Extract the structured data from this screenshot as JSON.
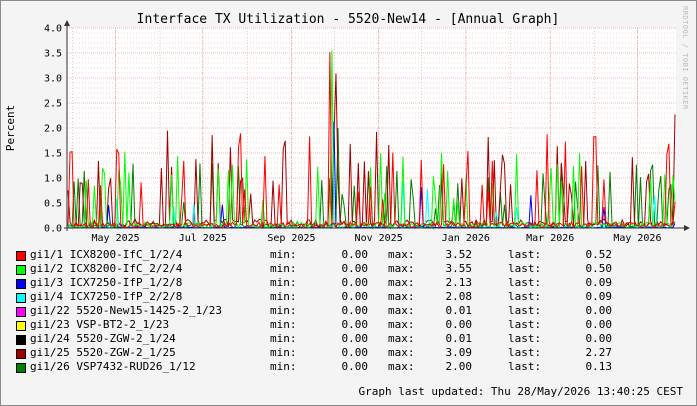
{
  "chart_data": {
    "type": "line",
    "title": "Interface TX Utilization - 5520-New14 - [Annual Graph]",
    "ylabel": "Percent",
    "xlabel": "",
    "ylim": [
      0,
      4.0
    ],
    "y_ticks": [
      "0.0",
      "0.5",
      "1.0",
      "1.5",
      "2.0",
      "2.5",
      "3.0",
      "3.5",
      "4.0"
    ],
    "x_ticks": [
      "May 2025",
      "Jul 2025",
      "Sep 2025",
      "Nov 2025",
      "Jan 2026",
      "Mar 2026",
      "May 2026"
    ],
    "x_range": [
      "2025-03-28",
      "2026-05-28"
    ],
    "grid": true,
    "series": [
      {
        "name": "gi1/1 ICX8200-IfC_1/2/4",
        "color": "#ff0000",
        "min": "0.00",
        "max": "3.52",
        "last": "0.52"
      },
      {
        "name": "gi1/2 ICX8200-IfC_2/2/4",
        "color": "#00ff00",
        "min": "0.00",
        "max": "3.55",
        "last": "0.50"
      },
      {
        "name": "gi1/3 ICX7250-IfP_1/2/8",
        "color": "#0000ff",
        "min": "0.00",
        "max": "2.13",
        "last": "0.09"
      },
      {
        "name": "gi1/4 ICX7250-IfP_2/2/8",
        "color": "#00ffff",
        "min": "0.00",
        "max": "2.08",
        "last": "0.09"
      },
      {
        "name": "gi1/22 5520-New15-1425-2_1/23",
        "color": "#ff00ff",
        "min": "0.00",
        "max": "0.01",
        "last": "0.00"
      },
      {
        "name": "gi1/23 VSP-BT2-2_1/23",
        "color": "#ffff00",
        "min": "0.00",
        "max": "0.00",
        "last": "0.00"
      },
      {
        "name": "gi1/24 5520-ZGW-2_1/24",
        "color": "#000000",
        "min": "0.00",
        "max": "0.01",
        "last": "0.00"
      },
      {
        "name": "gi1/25 5520-ZGW-2_1/25",
        "color": "#a00000",
        "min": "0.00",
        "max": "3.09",
        "last": "2.27"
      },
      {
        "name": "gi1/26 VSP7432-RUD26_1/12",
        "color": "#008000",
        "min": "0.00",
        "max": "2.00",
        "last": "0.13"
      }
    ]
  },
  "legend_labels": {
    "min": "min:",
    "max": "max:",
    "last": "last:"
  },
  "updated": "Graph last updated: Thu 28/May/2026 13:40:25 CEST",
  "watermark": "RRDTOOL / TOBI OETIKER"
}
